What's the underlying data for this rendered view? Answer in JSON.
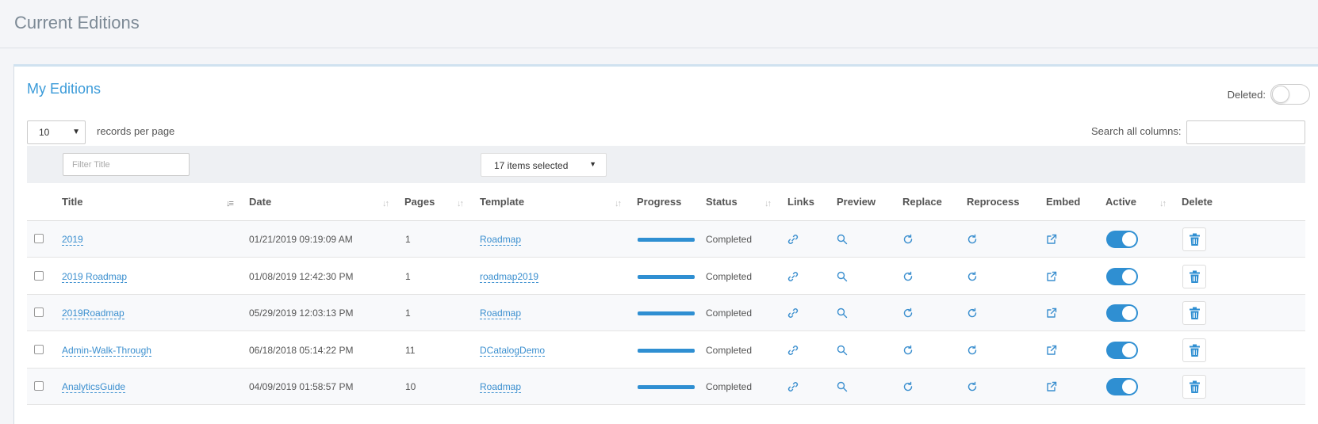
{
  "page": {
    "title": "Current Editions"
  },
  "panel": {
    "title": "My Editions",
    "deleted_label": "Deleted:",
    "deleted_toggle_on": false
  },
  "length": {
    "value": "10",
    "label": "records per page"
  },
  "search": {
    "label": "Search all columns:",
    "value": ""
  },
  "filters": {
    "title_placeholder": "Filter Title",
    "template_selected": "17 items selected"
  },
  "columns": [
    "Title",
    "Date",
    "Pages",
    "Template",
    "Progress",
    "Status",
    "Links",
    "Preview",
    "Replace",
    "Reprocess",
    "Embed",
    "Active",
    "Delete"
  ],
  "sorted_column": "Title",
  "rows": [
    {
      "title": "2019",
      "date": "01/21/2019 09:19:09 AM",
      "pages": "1",
      "template": "Roadmap",
      "progress": 1.0,
      "status": "Completed",
      "active": true
    },
    {
      "title": "2019 Roadmap",
      "date": "01/08/2019 12:42:30 PM",
      "pages": "1",
      "template": "roadmap2019",
      "progress": 1.0,
      "status": "Completed",
      "active": true
    },
    {
      "title": "2019Roadmap",
      "date": "05/29/2019 12:03:13 PM",
      "pages": "1",
      "template": "Roadmap",
      "progress": 1.0,
      "status": "Completed",
      "active": true
    },
    {
      "title": "Admin-Walk-Through",
      "date": "06/18/2018 05:14:22 PM",
      "pages": "11",
      "template": "DCatalogDemo",
      "progress": 1.0,
      "status": "Completed",
      "active": true
    },
    {
      "title": "AnalyticsGuide",
      "date": "04/09/2019 01:58:57 PM",
      "pages": "10",
      "template": "Roadmap",
      "progress": 1.0,
      "status": "Completed",
      "active": true
    }
  ],
  "icons": {
    "links": "link-icon",
    "preview": "search-icon",
    "replace": "refresh-icon",
    "reprocess": "refresh-icon",
    "embed": "external-link-icon",
    "delete": "trash-icon"
  },
  "colors": {
    "accent": "#2f8fd2",
    "link": "#3b8fcf",
    "title": "#3b9bd9"
  }
}
